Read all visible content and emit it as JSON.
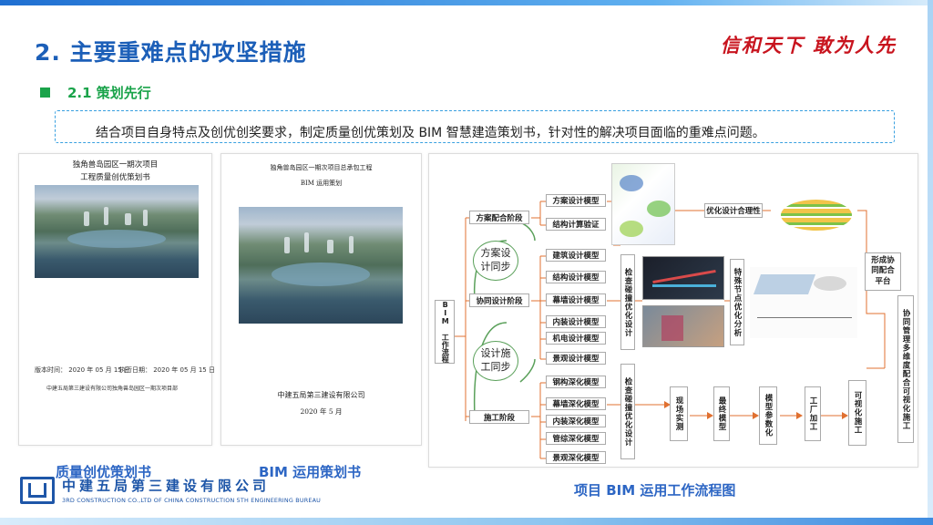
{
  "header": {
    "title": "2.  主要重难点的攻坚措施",
    "slogan": "信和天下  敢为人先"
  },
  "section": {
    "subtitle": "2.1  策划先行",
    "note": "结合项目自身特点及创优创奖要求，制定质量创优策划及 BIM 智慧建造策划书，针对性的解决项目面临的重难点问题。"
  },
  "doc1": {
    "line1": "独角兽岛园区一期次项目",
    "line2": "工程质量创优策划书",
    "meta_left": "版本时间：  2020 年 05 月 15 日",
    "meta_right": "执行日期：  2020 年 05 月 15 日",
    "footer": "中建五局第三建设有限公司独角兽岛园区一期次项目部"
  },
  "doc2": {
    "line1": "独角兽岛园区一期次项目总承包工程",
    "line2": "BIM 运用策划",
    "company": "中建五局第三建设有限公司",
    "date": "2020 年 5 月"
  },
  "captions": {
    "doc1": "质量创优策划书",
    "doc2": "BIM 运用策划书",
    "flow": "项目 BIM 运用工作流程图"
  },
  "company": {
    "name_cn": "中建五局第三建设有限公司",
    "name_en": "3RD CONSTRUCTION CO.,LTD OF CHINA CONSTRUCTION 5TH ENGINEERING BUREAU"
  },
  "flow": {
    "root": "BIM 工作流程",
    "stage1": "方案配合阶段",
    "stage2": "协同设计阶段",
    "stage3": "施工阶段",
    "oval1": "方案设\n计同步",
    "oval2": "设计施\n工同步",
    "s1_items": [
      "方案设计模型",
      "结构计算验证"
    ],
    "s2_items": [
      "建筑设计模型",
      "结构设计模型",
      "幕墙设计模型",
      "内装设计模型",
      "机电设计模型",
      "景观设计模型"
    ],
    "s3_items": [
      "钢构深化模型",
      "幕墙深化模型",
      "内装深化模型",
      "管综深化模型",
      "景观深化模型"
    ],
    "optimize": "优化设计合理性",
    "clash1": "检查碰撞优化设计",
    "clash2": "检查碰撞优化设计",
    "special": "特殊节点优化分析",
    "form": "形成协\n同配合\n平台",
    "chain": [
      "现场实测",
      "最终模型",
      "模型参数化",
      "工厂加工",
      "可视化施工"
    ],
    "collab": "协同管理多维度配合可视化施工"
  },
  "colors": {
    "title_blue": "#1c5fb8",
    "slogan_red": "#c8141e",
    "subtitle_green": "#1aa34a",
    "caption_blue": "#2d66c4"
  }
}
